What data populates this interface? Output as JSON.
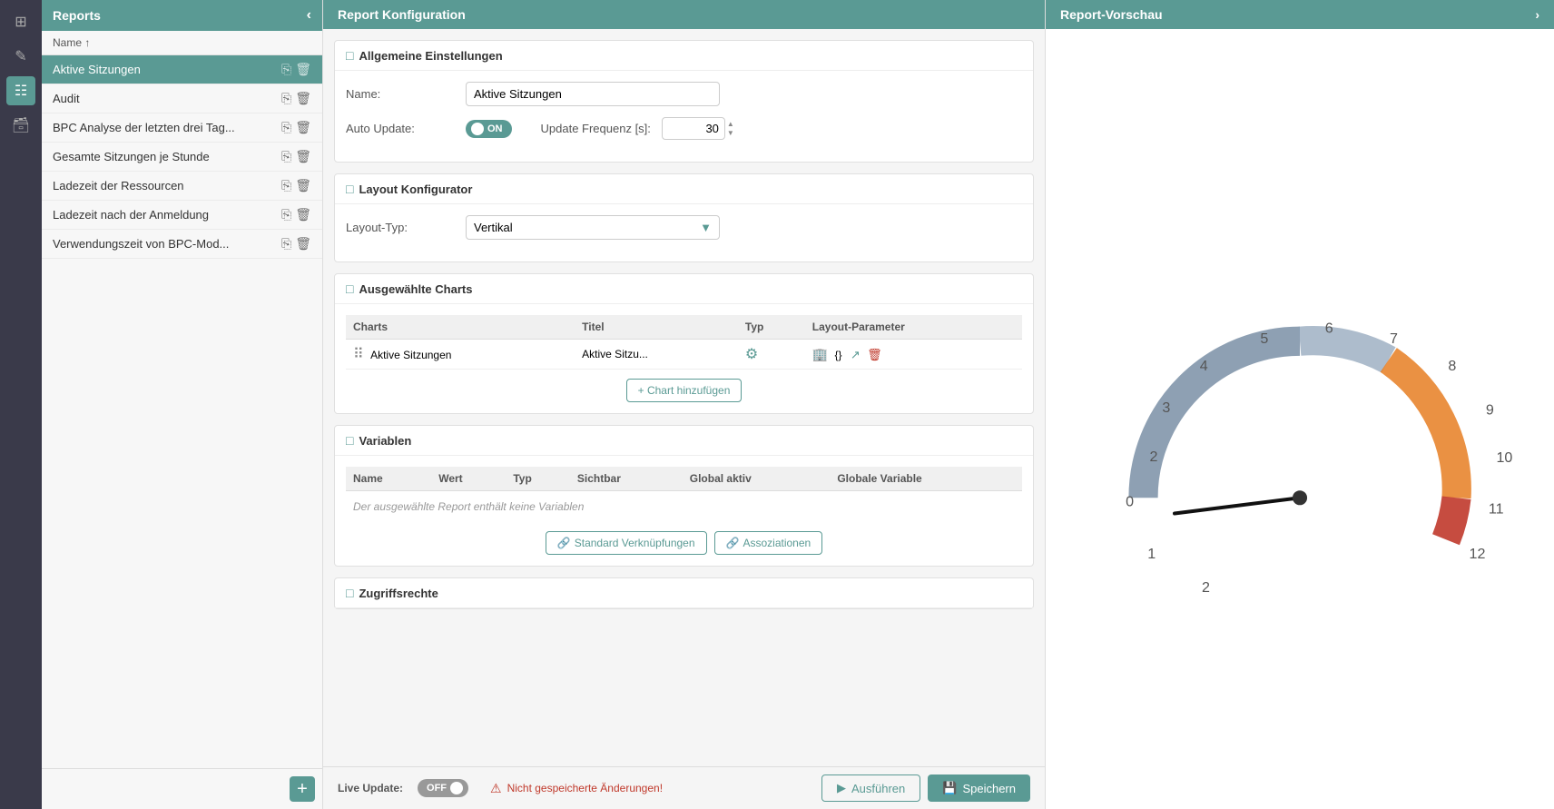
{
  "sidebar": {
    "icons": [
      {
        "name": "home-icon",
        "symbol": "⊞",
        "active": false
      },
      {
        "name": "edit-icon",
        "symbol": "✎",
        "active": false
      },
      {
        "name": "chart-icon",
        "symbol": "📊",
        "active": true
      },
      {
        "name": "db-icon",
        "symbol": "🗄",
        "active": false
      }
    ]
  },
  "left_panel": {
    "title": "Reports",
    "sort_label": "Name ↑",
    "items": [
      {
        "label": "Aktive Sitzungen",
        "active": true
      },
      {
        "label": "Audit",
        "active": false
      },
      {
        "label": "BPC Analyse der letzten drei Tag...",
        "active": false
      },
      {
        "label": "Gesamte Sitzungen je Stunde",
        "active": false
      },
      {
        "label": "Ladezeit der Ressourcen",
        "active": false
      },
      {
        "label": "Ladezeit nach der Anmeldung",
        "active": false
      },
      {
        "label": "Verwendungszeit von BPC-Mod...",
        "active": false
      }
    ],
    "add_button": "+"
  },
  "center_panel": {
    "title": "Report Konfiguration",
    "sections": {
      "general": {
        "title": "Allgemeine Einstellungen",
        "name_label": "Name:",
        "name_value": "Aktive Sitzungen",
        "auto_update_label": "Auto Update:",
        "toggle_state": "ON",
        "freq_label": "Update Frequenz [s]:",
        "freq_value": "30"
      },
      "layout": {
        "title": "Layout Konfigurator",
        "type_label": "Layout-Typ:",
        "type_value": "Vertikal"
      },
      "charts": {
        "title": "Ausgewählte Charts",
        "columns": [
          "Charts",
          "Titel",
          "Typ",
          "Layout-Parameter"
        ],
        "rows": [
          {
            "charts": "Aktive Sitzungen",
            "titel": "Aktive Sitzu...",
            "typ": "",
            "layout_param": "{}"
          }
        ],
        "add_button": "+ Chart hinzufügen"
      },
      "variablen": {
        "title": "Variablen",
        "columns": [
          "Name",
          "Wert",
          "Typ",
          "Sichtbar",
          "Global aktiv",
          "Globale Variable"
        ],
        "empty_message": "Der ausgewählte Report enthält keine Variablen",
        "btn_standard": "Standard Verknüpfungen",
        "btn_assoc": "Assoziationen"
      },
      "zugriffsrechte": {
        "title": "Zugriffsrechte"
      }
    }
  },
  "bottom_bar": {
    "live_update_label": "Live Update:",
    "toggle_off_label": "OFF",
    "warning_icon": "⚠",
    "warning_text": "Nicht gespeicherte Änderungen!",
    "run_label": "Ausführen",
    "save_label": "Speichern"
  },
  "right_panel": {
    "title": "Report-Vorschau",
    "gauge": {
      "labels": [
        "0",
        "1",
        "2",
        "3",
        "4",
        "5",
        "6",
        "7",
        "8",
        "9",
        "10",
        "11",
        "12"
      ],
      "needle_value": 1.5
    }
  },
  "colors": {
    "teal": "#5a9a94",
    "teal_dark": "#4a8a84",
    "red": "#c0392b",
    "orange": "#e67e22",
    "gray_blue": "#7a8fa6"
  }
}
